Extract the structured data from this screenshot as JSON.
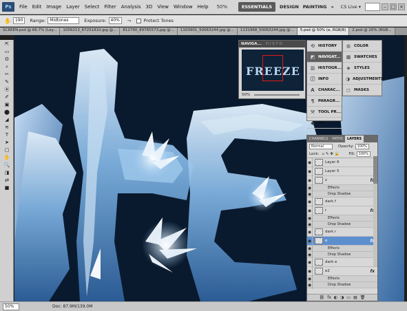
{
  "app": {
    "logo": "Ps",
    "zoom": "50%"
  },
  "menu": [
    "File",
    "Edit",
    "Image",
    "Layer",
    "Select",
    "Filter",
    "Analysis",
    "3D",
    "View",
    "Window",
    "Help"
  ],
  "workspaces": {
    "essentials": "ESSENTIALS",
    "design": "DESIGN",
    "painting": "PAINTING",
    "more": "»",
    "cslive": "CS Live ▾"
  },
  "options": {
    "brush_size": "190",
    "range_label": "Range:",
    "range_value": "Midtones",
    "exposure_label": "Exposure:",
    "exposure_value": "40%",
    "protect_label": "Protect Tones"
  },
  "doc_tabs": [
    "SCREEN.psd @ 66.7% (Lay...",
    "1056213_87251810.jpg @...",
    "812790_89765573.jpg @...",
    "1103901_50063244.jpg @...",
    "1131968_50063244.jpg @...",
    "5.psd @ 50% (e, RGB/8)",
    "2.psd @ 20% (RGB..."
  ],
  "active_tab_index": 5,
  "tools": [
    "⇱",
    "▭",
    "ʘ",
    "⌕",
    "✂",
    "✎",
    "⦿",
    "✐",
    "▣",
    "⬤",
    "◢",
    "≋",
    "T",
    "➤",
    "▢",
    "✋",
    "🔍",
    "◨",
    "⇄",
    "■"
  ],
  "navigator": {
    "title": "NAVIGA...",
    "faded_tabs": "H  I  S  T  O",
    "preview_text": "FREEZE",
    "zoom": "50%"
  },
  "dock_col1": [
    {
      "icon": "history-icon",
      "glyph": "⟲",
      "label": "HISTORY"
    },
    {
      "icon": "navigator-icon",
      "glyph": "◩",
      "label": "NAVIGAT...",
      "active": true
    },
    {
      "icon": "histogram-icon",
      "glyph": "▥",
      "label": "HISTOGR..."
    },
    {
      "icon": "info-icon",
      "glyph": "ⓘ",
      "label": "INFO"
    },
    {
      "icon": "character-icon",
      "glyph": "A",
      "label": "CHARAC..."
    },
    {
      "icon": "paragraph-icon",
      "glyph": "¶",
      "label": "PARAGR..."
    },
    {
      "icon": "tool-presets-icon",
      "glyph": "⚒",
      "label": "TOOL PR..."
    },
    {
      "icon": "3d-icon",
      "glyph": "◆",
      "label": "3D"
    }
  ],
  "dock_col2": [
    {
      "icon": "color-icon",
      "glyph": "◍",
      "label": "COLOR"
    },
    {
      "icon": "swatches-icon",
      "glyph": "▦",
      "label": "SWATCHES"
    },
    {
      "icon": "styles-icon",
      "glyph": "◈",
      "label": "STYLES"
    },
    {
      "icon": "adjustments-icon",
      "glyph": "◑",
      "label": "ADJUSTMENTS"
    },
    {
      "icon": "masks-icon",
      "glyph": "◻",
      "label": "MASKS"
    }
  ],
  "layers": {
    "tabs": [
      "CHANNELS",
      "PATHS",
      "LAYERS"
    ],
    "blend_mode": "Normal",
    "opacity_label": "Opacity:",
    "opacity": "100%",
    "lock_label": "Lock:",
    "fill_label": "Fill:",
    "fill": "100%",
    "rows": [
      {
        "name": "Layer 6",
        "type": "layer"
      },
      {
        "name": "Layer 5",
        "type": "layer"
      },
      {
        "name": "z",
        "type": "layer",
        "fx": true
      },
      {
        "name": "Effects",
        "type": "sub"
      },
      {
        "name": "Drop Shadow",
        "type": "sub"
      },
      {
        "name": "dark f",
        "type": "layer"
      },
      {
        "name": "r",
        "type": "layer",
        "fx": true
      },
      {
        "name": "Effects",
        "type": "sub"
      },
      {
        "name": "Drop Shadow",
        "type": "sub"
      },
      {
        "name": "dark r",
        "type": "layer"
      },
      {
        "name": "e",
        "type": "layer",
        "fx": true,
        "selected": true
      },
      {
        "name": "Effects",
        "type": "sub"
      },
      {
        "name": "Drop Shadow",
        "type": "sub"
      },
      {
        "name": "dark e",
        "type": "layer"
      },
      {
        "name": "e2",
        "type": "layer",
        "fx": true
      },
      {
        "name": "Effects",
        "type": "sub"
      },
      {
        "name": "Drop Shadow",
        "type": "sub"
      },
      {
        "name": "dark e2",
        "type": "layer"
      }
    ],
    "footer": [
      "⛓",
      "fx",
      "◐",
      "◑",
      "▭",
      "▤",
      "🗑"
    ]
  },
  "status": {
    "zoom": "50%",
    "doc": "Doc: 87.9M/139.0M"
  }
}
